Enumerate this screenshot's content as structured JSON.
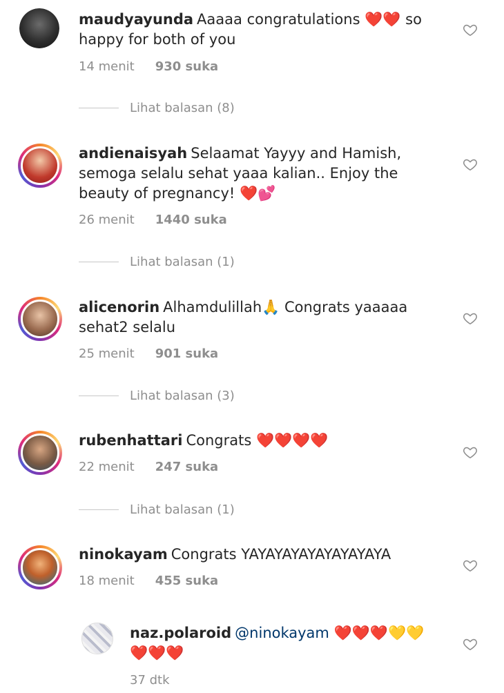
{
  "comments": [
    {
      "username": "maudyayunda",
      "text": "Aaaaa congratulations ❤️❤️ so happy for both of you",
      "time": "14 menit",
      "likes": "930 suka",
      "replies": "Lihat balasan (8)"
    },
    {
      "username": "andienaisyah",
      "text": "Selaamat Yayyy and Hamish, semoga selalu sehat yaaa kalian.. Enjoy the beauty of pregnancy! ❤️💕",
      "time": "26 menit",
      "likes": "1440 suka",
      "replies": "Lihat balasan (1)"
    },
    {
      "username": "alicenorin",
      "text": "Alhamdulillah🙏 Congrats yaaaaa sehat2 selalu",
      "time": "25 menit",
      "likes": "901 suka",
      "replies": "Lihat balasan (3)"
    },
    {
      "username": "rubenhattari",
      "text": "Congrats ❤️❤️❤️❤️",
      "time": "22 menit",
      "likes": "247 suka",
      "replies": "Lihat balasan (1)"
    },
    {
      "username": "ninokayam",
      "text": "Congrats YAYAYAYAYAYAYAYAYA",
      "time": "18 menit",
      "likes": "455 suka"
    }
  ],
  "reply": {
    "username": "naz.polaroid",
    "mention": "@ninokayam",
    "text": "❤️❤️❤️💛💛 ❤️❤️❤️",
    "time": "37 dtk"
  },
  "colors": {
    "text": "#262626",
    "meta": "#8e8e8e",
    "mention": "#00376b",
    "heart_outline": "#8e8e8e"
  },
  "icons": {
    "like": "heart-outline-icon"
  }
}
